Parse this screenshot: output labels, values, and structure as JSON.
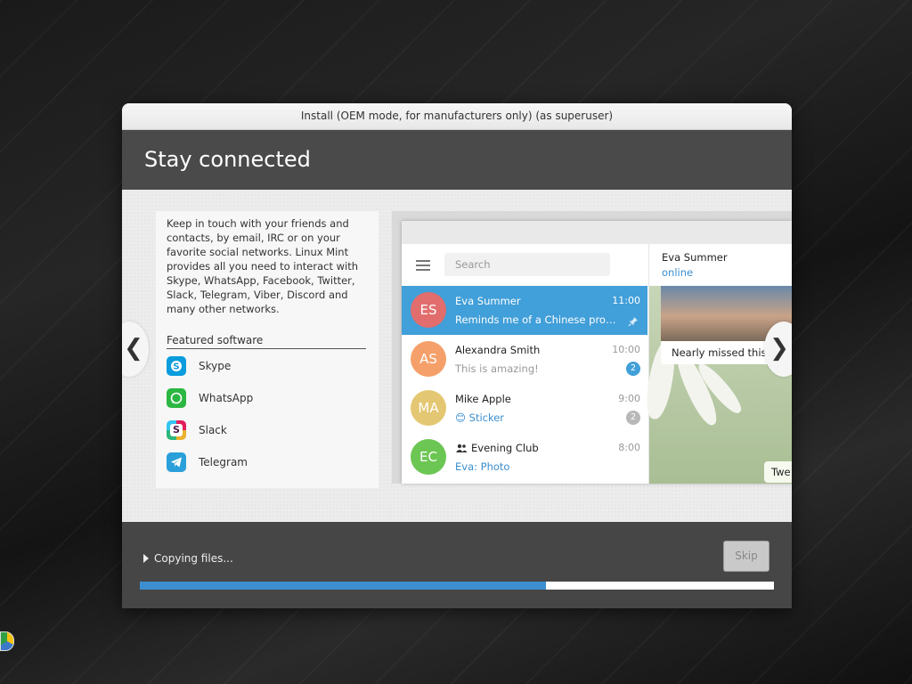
{
  "window": {
    "title": "Install (OEM mode, for manufacturers only) (as superuser)"
  },
  "header": {
    "title": "Stay connected"
  },
  "slide": {
    "description": "Keep in touch with your friends and contacts, by email, IRC or on your favorite social networks. Linux Mint provides all you need to interact with Skype, WhatsApp, Facebook, Twitter, Slack, Telegram, Viber, Discord and many other networks.",
    "featured_title": "Featured software",
    "software": [
      {
        "name": "Skype",
        "icon": "skype-icon",
        "color": "#0a9cdc"
      },
      {
        "name": "WhatsApp",
        "icon": "whatsapp-icon",
        "color": "#2bb741"
      },
      {
        "name": "Slack",
        "icon": "slack-icon",
        "color": "#4a154b"
      },
      {
        "name": "Telegram",
        "icon": "telegram-icon",
        "color": "#2b9fd9"
      }
    ],
    "prev_glyph": "❮",
    "next_glyph": "❯"
  },
  "telegram": {
    "search_placeholder": "Search",
    "chats": [
      {
        "initials": "ES",
        "name": "Eva Summer",
        "time": "11:00",
        "message": "Reminds me of a Chinese proverb",
        "color": "#e26d6d",
        "active": true
      },
      {
        "initials": "AS",
        "name": "Alexandra Smith",
        "time": "10:00",
        "message": "This is amazing!",
        "badge": "2",
        "badge_color": "#419fd9",
        "color": "#f5a06a"
      },
      {
        "initials": "MA",
        "name": "Mike Apple",
        "time": "9:00",
        "message": "Sticker",
        "emoji": "😊",
        "badge": "2",
        "badge_color": "#b8b8b8",
        "color": "#e4c772"
      },
      {
        "initials": "EC",
        "name": "Evening Club",
        "time": "8:00",
        "message": "Eva: Photo",
        "color": "#6cc653"
      }
    ],
    "pane": {
      "name": "Eva Summer",
      "status": "online",
      "bubble": "Nearly missed this sunrise",
      "tweet": "Twe"
    }
  },
  "footer": {
    "progress_label": "Copying files...",
    "progress": 0.64,
    "skip_label": "Skip"
  },
  "colors": {
    "accent": "#3d8fcf",
    "header_bg": "#4a4a4a",
    "footer_bg": "#464646"
  }
}
